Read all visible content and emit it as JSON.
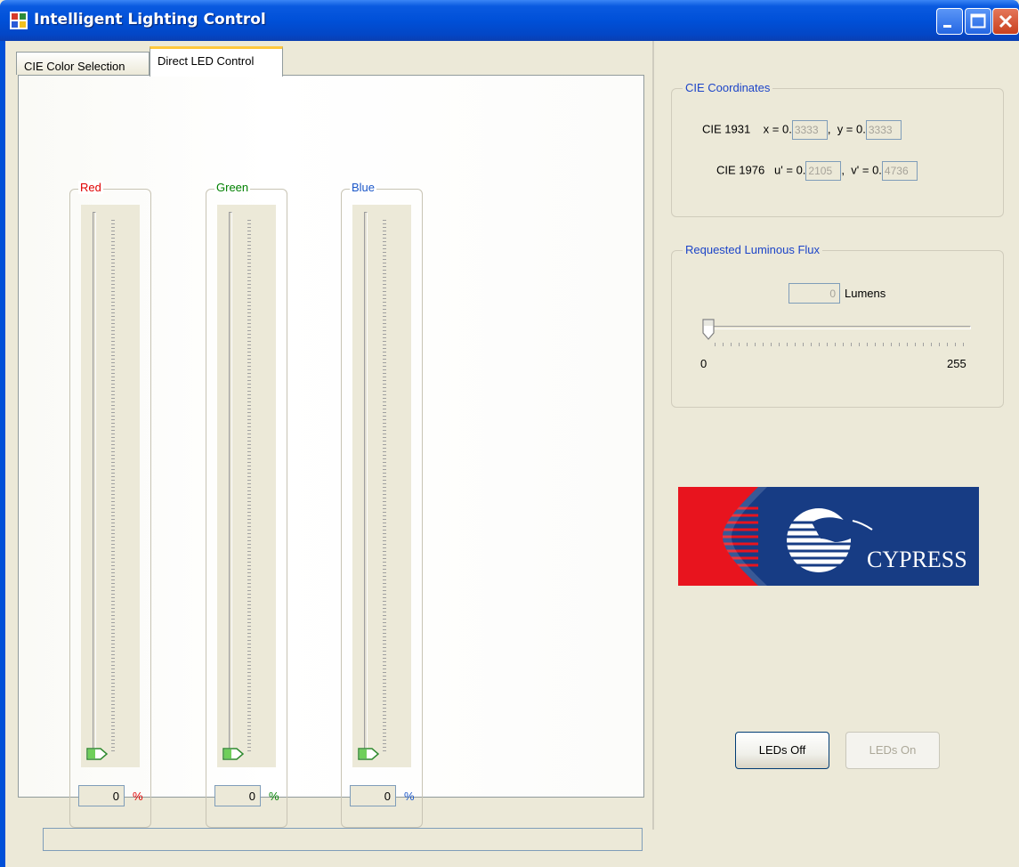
{
  "window": {
    "title": "Intelligent Lighting Control"
  },
  "tabs": [
    {
      "label": "CIE Color Selection",
      "active": false
    },
    {
      "label": "Direct LED Control",
      "active": true
    }
  ],
  "channels": [
    {
      "label": "Red",
      "color": "#e00000",
      "value": "0",
      "unit": "%",
      "level": 0
    },
    {
      "label": "Green",
      "color": "#008000",
      "value": "0",
      "unit": "%",
      "level": 0
    },
    {
      "label": "Blue",
      "color": "#1a56c8",
      "value": "0",
      "unit": "%",
      "level": 0
    }
  ],
  "cie": {
    "group_title": "CIE Coordinates",
    "row1": {
      "label": "CIE 1931",
      "a_label": "x = 0.",
      "a_value": "3333",
      "sep": ",",
      "b_label": "y = 0.",
      "b_value": "3333"
    },
    "row2": {
      "label": "CIE 1976",
      "a_label": "u' = 0.",
      "a_value": "2105",
      "sep": ",",
      "b_label": "v' = 0.",
      "b_value": "4736"
    }
  },
  "flux": {
    "group_title": "Requested Luminous Flux",
    "value": "0",
    "unit": "Lumens",
    "min_label": "0",
    "max_label": "255",
    "level": 0
  },
  "buttons": {
    "off": "LEDs Off",
    "on": "LEDs On"
  },
  "logo": {
    "text": "CYPRESS"
  },
  "colors": {
    "titlebar": "#0050d8",
    "group_title": "#1c44c8",
    "logo_bg": "#173c84",
    "logo_red": "#e8141e"
  }
}
